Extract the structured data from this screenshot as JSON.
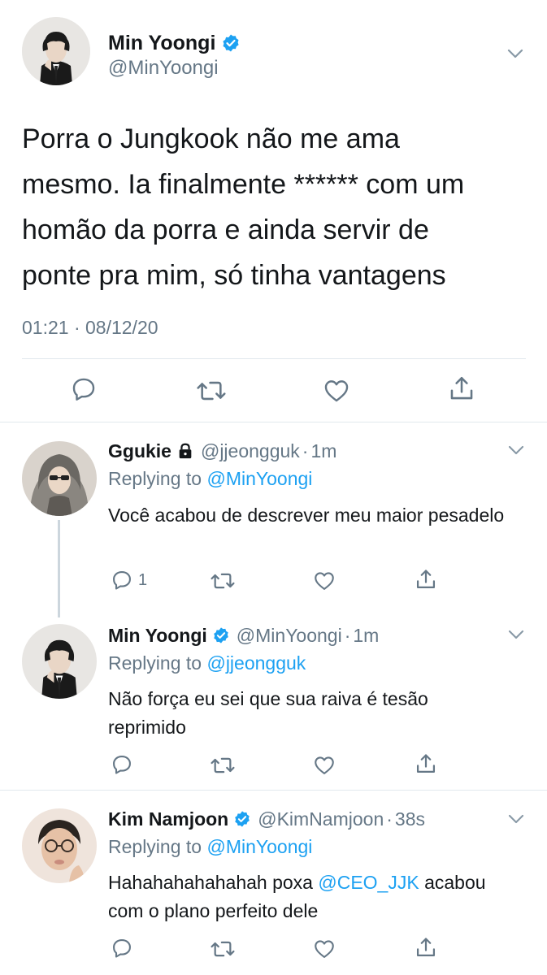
{
  "main": {
    "name": "Min Yoongi",
    "handle": "@MinYoongi",
    "body": "Porra o Jungkook não me ama\nmesmo. Ia finalmente ****** com um\nhomão da porra e ainda servir de\nponte pra mim, só tinha vantagens",
    "time": "01:21 · 08/12/20"
  },
  "replies": [
    {
      "name": "Ggukie",
      "handle": "@jjeongguk",
      "time": "1m",
      "replying_prefix": "Replying to ",
      "replying_to": "@MinYoongi",
      "text": "Você acabou de descrever meu maior pesadelo",
      "reply_count": "1"
    },
    {
      "name": "Min Yoongi",
      "handle": "@MinYoongi",
      "time": "1m",
      "replying_prefix": "Replying to ",
      "replying_to": "@jjeongguk",
      "text": "Não força eu sei que sua raiva é tesão reprimido"
    },
    {
      "name": "Kim Namjoon",
      "handle": "@KimNamjoon",
      "time": "38s",
      "replying_prefix": "Replying to ",
      "replying_to": "@MinYoongi",
      "text_before": "Hahahahahahahah poxa ",
      "text_mention": "@CEO_JJK",
      "text_after": " acabou com o plano perfeito dele"
    }
  ],
  "separator": "·",
  "colors": {
    "accent": "#1da1f2",
    "text": "#14171a",
    "muted": "#657786",
    "divider": "#e1e8ed"
  },
  "icons": [
    "verified-badge-icon",
    "chevron-down-icon",
    "reply-icon",
    "retweet-icon",
    "like-icon",
    "share-icon",
    "lock-icon"
  ]
}
